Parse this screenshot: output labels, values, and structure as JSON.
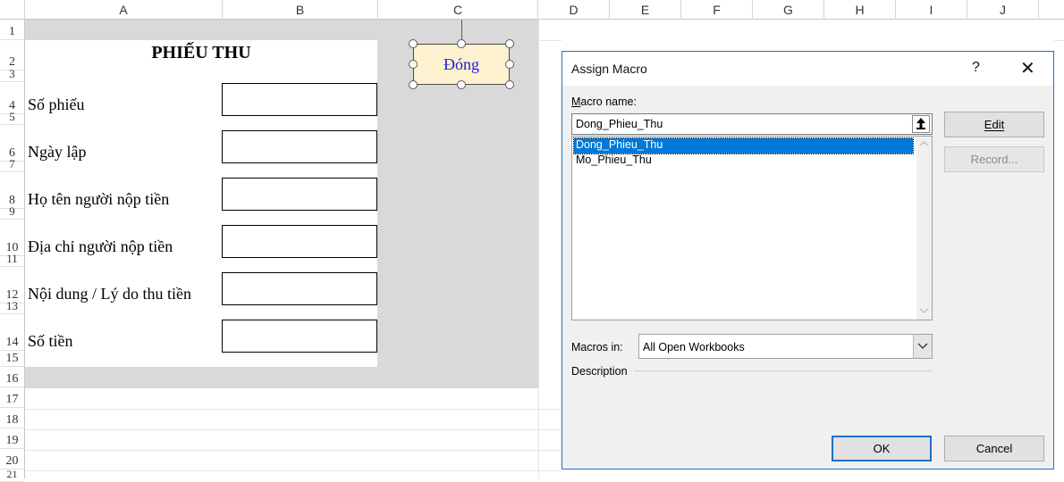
{
  "spreadsheet": {
    "columns": [
      "A",
      "B",
      "C",
      "D",
      "E",
      "F",
      "G",
      "H",
      "I",
      "J"
    ],
    "rows": [
      "1",
      "2",
      "3",
      "4",
      "5",
      "6",
      "7",
      "8",
      "9",
      "10",
      "11",
      "12",
      "13",
      "14",
      "15",
      "16",
      "17",
      "18",
      "19",
      "20",
      "21"
    ],
    "form": {
      "title": "PHIẾU THU",
      "fields": [
        {
          "label": "Số phiếu",
          "value": ""
        },
        {
          "label": "Ngày lập",
          "value": ""
        },
        {
          "label": "Họ tên người nộp tiền",
          "value": ""
        },
        {
          "label": "Địa chỉ người nộp tiền",
          "value": ""
        },
        {
          "label": "Nội dung / Lý do thu tiền",
          "value": ""
        },
        {
          "label": "Số tiền",
          "value": ""
        }
      ]
    },
    "shape_button": {
      "label": "Đóng"
    }
  },
  "dialog": {
    "title": "Assign Macro",
    "help": "?",
    "close": "✕",
    "macro_name_label": "Macro name:",
    "macro_name_value": "Dong_Phieu_Thu",
    "macros": [
      "Dong_Phieu_Thu",
      "Mo_Phieu_Thu"
    ],
    "selected_macro": "Dong_Phieu_Thu",
    "edit_label": "Edit",
    "record_label": "Record...",
    "macros_in_label": "Macros in:",
    "macros_in_value": "All Open Workbooks",
    "description_label": "Description",
    "ok_label": "OK",
    "cancel_label": "Cancel"
  },
  "colors": {
    "accent": "#0078d7",
    "shape_fill": "#fdf1cf",
    "shape_text": "#1f1fd6",
    "sheet_gray": "#d9d9d9"
  }
}
